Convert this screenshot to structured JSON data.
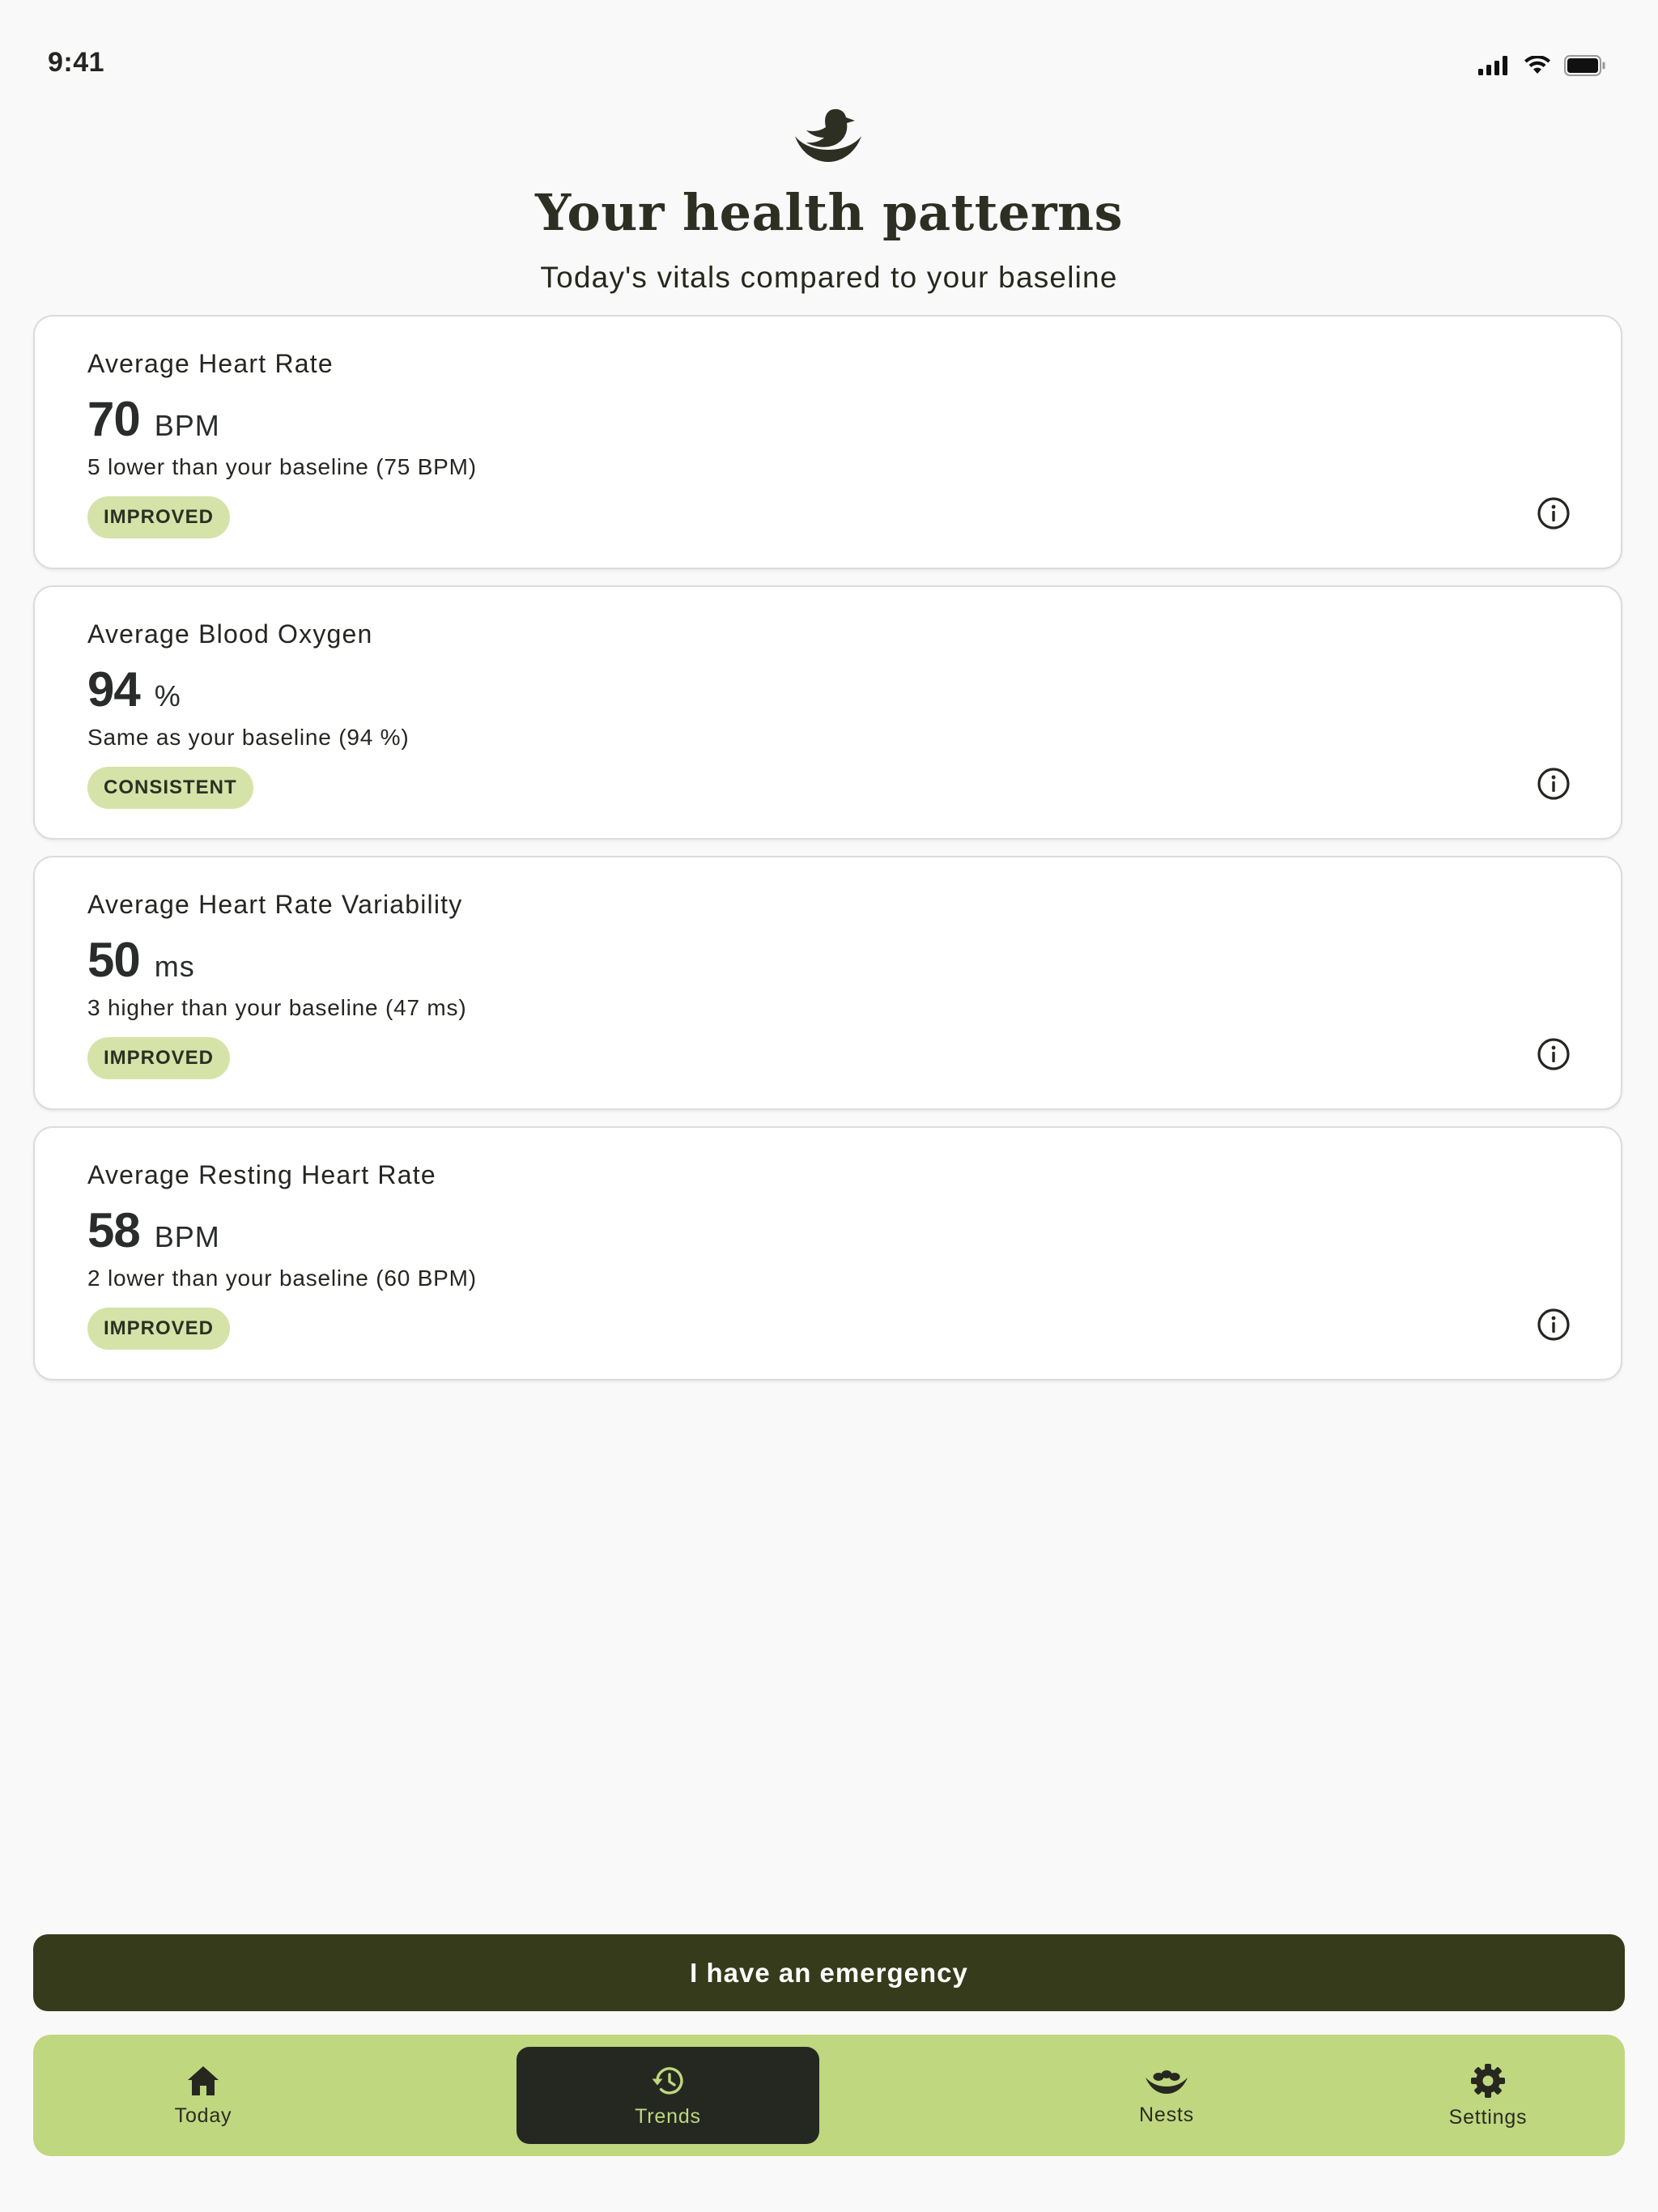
{
  "status_bar": {
    "time": "9:41"
  },
  "header": {
    "logo_icon": "bird-in-nest-icon",
    "title": "Your health patterns",
    "subtitle": "Today's vitals compared to your baseline"
  },
  "metrics": [
    {
      "label": "Average Heart Rate",
      "value": "70",
      "unit": "BPM",
      "description": "5 lower than your baseline (75 BPM)",
      "status": "IMPROVED"
    },
    {
      "label": "Average Blood Oxygen",
      "value": "94",
      "unit": "%",
      "description": "Same as your baseline (94 %)",
      "status": "CONSISTENT"
    },
    {
      "label": "Average Heart Rate Variability",
      "value": "50",
      "unit": "ms",
      "description": "3 higher than your baseline (47 ms)",
      "status": "IMPROVED"
    },
    {
      "label": "Average Resting Heart Rate",
      "value": "58",
      "unit": "BPM",
      "description": "2 lower than your baseline (60 BPM)",
      "status": "IMPROVED"
    }
  ],
  "emergency": {
    "label": "I have an emergency"
  },
  "tabs": [
    {
      "label": "Today",
      "icon": "home-icon",
      "active": false
    },
    {
      "label": "Trends",
      "icon": "history-icon",
      "active": true
    },
    {
      "label": "Nests",
      "icon": "nest-icon",
      "active": false
    },
    {
      "label": "Settings",
      "icon": "gear-icon",
      "active": false
    }
  ],
  "colors": {
    "background": "#f9f9f9",
    "primary_dark": "#363c1b",
    "accent_green": "#bfd77f",
    "badge_green": "#d5e3a8",
    "text": "#252622"
  }
}
